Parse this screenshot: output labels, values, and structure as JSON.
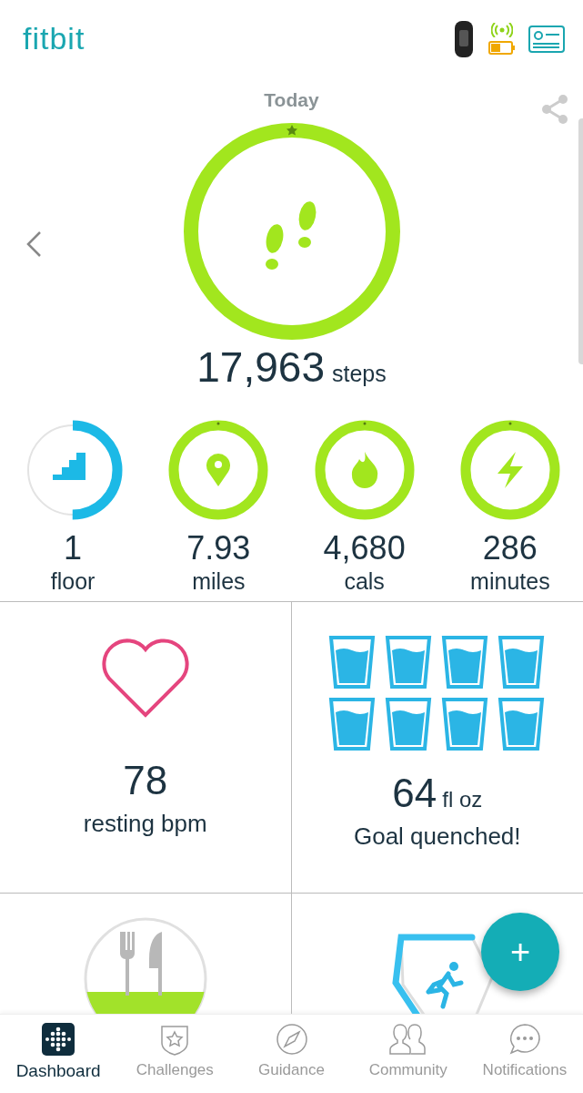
{
  "header": {
    "logo": "fitbit"
  },
  "day": {
    "title": "Today"
  },
  "steps": {
    "value": "17,963",
    "unit": "steps",
    "level": 1
  },
  "stats": [
    {
      "kind": "floors",
      "value": "1",
      "unit": "floor",
      "level": 0.5
    },
    {
      "kind": "distance",
      "value": "7.93",
      "unit": "miles",
      "level": 1
    },
    {
      "kind": "calories",
      "value": "4,680",
      "unit": "cals",
      "level": 1
    },
    {
      "kind": "active",
      "value": "286",
      "unit": "minutes",
      "level": 1
    }
  ],
  "tiles": [
    {
      "kind": "heart",
      "value": "78",
      "label": "resting bpm"
    },
    {
      "kind": "water",
      "value": "64",
      "unit": "fl oz",
      "label": "Goal quenched!"
    },
    {
      "kind": "food"
    },
    {
      "kind": "exercise"
    }
  ],
  "nav": [
    {
      "kind": "dashboard",
      "label": "Dashboard",
      "selected": true
    },
    {
      "kind": "challenges",
      "label": "Challenges",
      "selected": false
    },
    {
      "kind": "guidance",
      "label": "Guidance",
      "selected": false
    },
    {
      "kind": "community",
      "label": "Community",
      "selected": false
    },
    {
      "kind": "notifications",
      "label": "Notifications",
      "selected": false
    }
  ],
  "fab": {
    "label": "+"
  }
}
